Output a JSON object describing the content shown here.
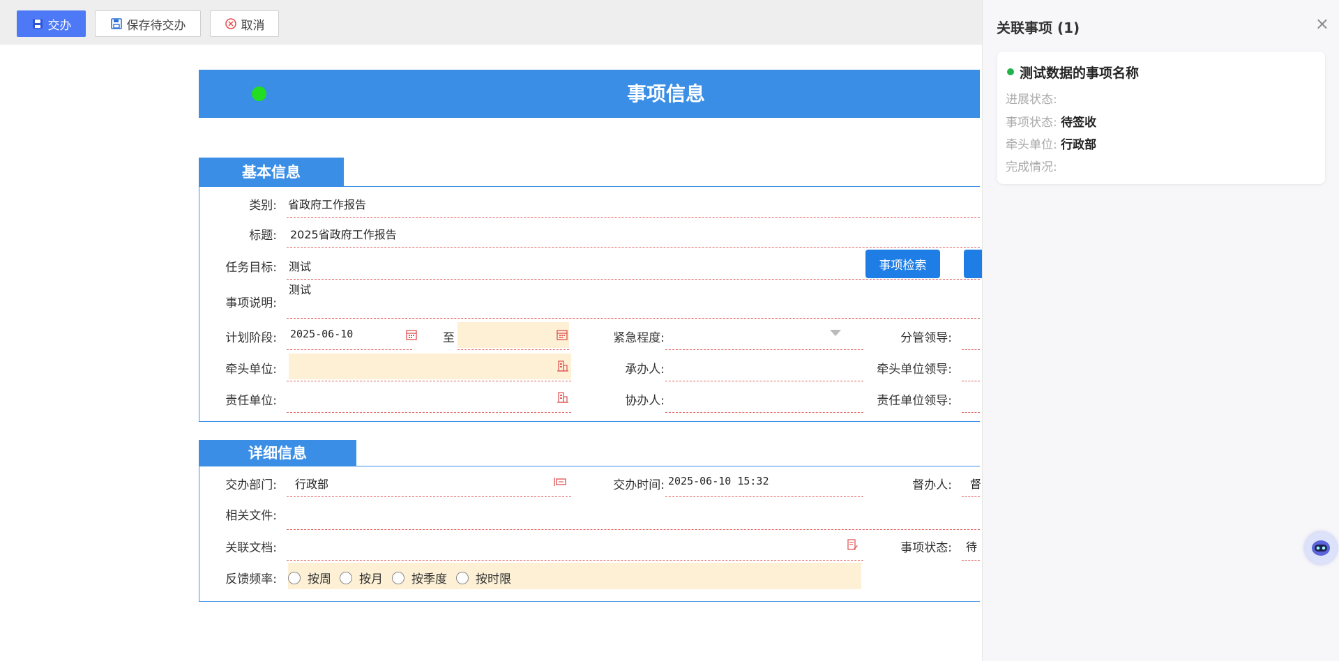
{
  "toolbar": {
    "submit_label": "交办",
    "save_pending_label": "保存待交办",
    "cancel_label": "取消"
  },
  "header": {
    "title": "事项信息"
  },
  "basic": {
    "section_title": "基本信息",
    "category_label": "类别:",
    "category_value": "省政府工作报告",
    "title_label": "标题:",
    "title_value": "2025省政府工作报告",
    "goal_label": "任务目标:",
    "goal_value": "测试",
    "search_button": "事项检索",
    "desc_label": "事项说明:",
    "desc_value": "测试",
    "plan_label": "计划阶段:",
    "plan_start": "2025-06-10",
    "plan_to": "至",
    "plan_end": "",
    "urgency_label": "紧急程度:",
    "urgency_value": "",
    "leader_label": "分管领导:",
    "lead_unit_label": "牵头单位:",
    "handler_label": "承办人:",
    "lead_unit_leader_label": "牵头单位领导:",
    "resp_unit_label": "责任单位:",
    "assistant_label": "协办人:",
    "resp_unit_leader_label": "责任单位领导:"
  },
  "detail": {
    "section_title": "详细信息",
    "dept_label": "交办部门:",
    "dept_value": "行政部",
    "time_label": "交办时间:",
    "time_value": "2025-06-10 15:32",
    "supervisor_label": "督办人:",
    "supervisor_value": "督",
    "files_label": "相关文件:",
    "docs_label": "关联文档:",
    "status_label": "事项状态:",
    "status_value": "待",
    "freq_label": "反馈频率:",
    "freq_options": [
      "按周",
      "按月",
      "按季度",
      "按时限"
    ]
  },
  "panel": {
    "title": "关联事项 (1)",
    "close": "×",
    "item": {
      "name": "测试数据的事项名称",
      "progress_label": "进展状态:",
      "progress_value": "",
      "status_label": "事项状态:",
      "status_value": "待签收",
      "lead_label": "牵头单位:",
      "lead_value": "行政部",
      "done_label": "完成情况:",
      "done_value": ""
    }
  },
  "colors": {
    "primary": "#4d79f6",
    "header_blue": "#3a8ee6",
    "highlight": "#fdf0d5",
    "dashed_line": "#e06060",
    "status_dot": "#21b24a"
  }
}
